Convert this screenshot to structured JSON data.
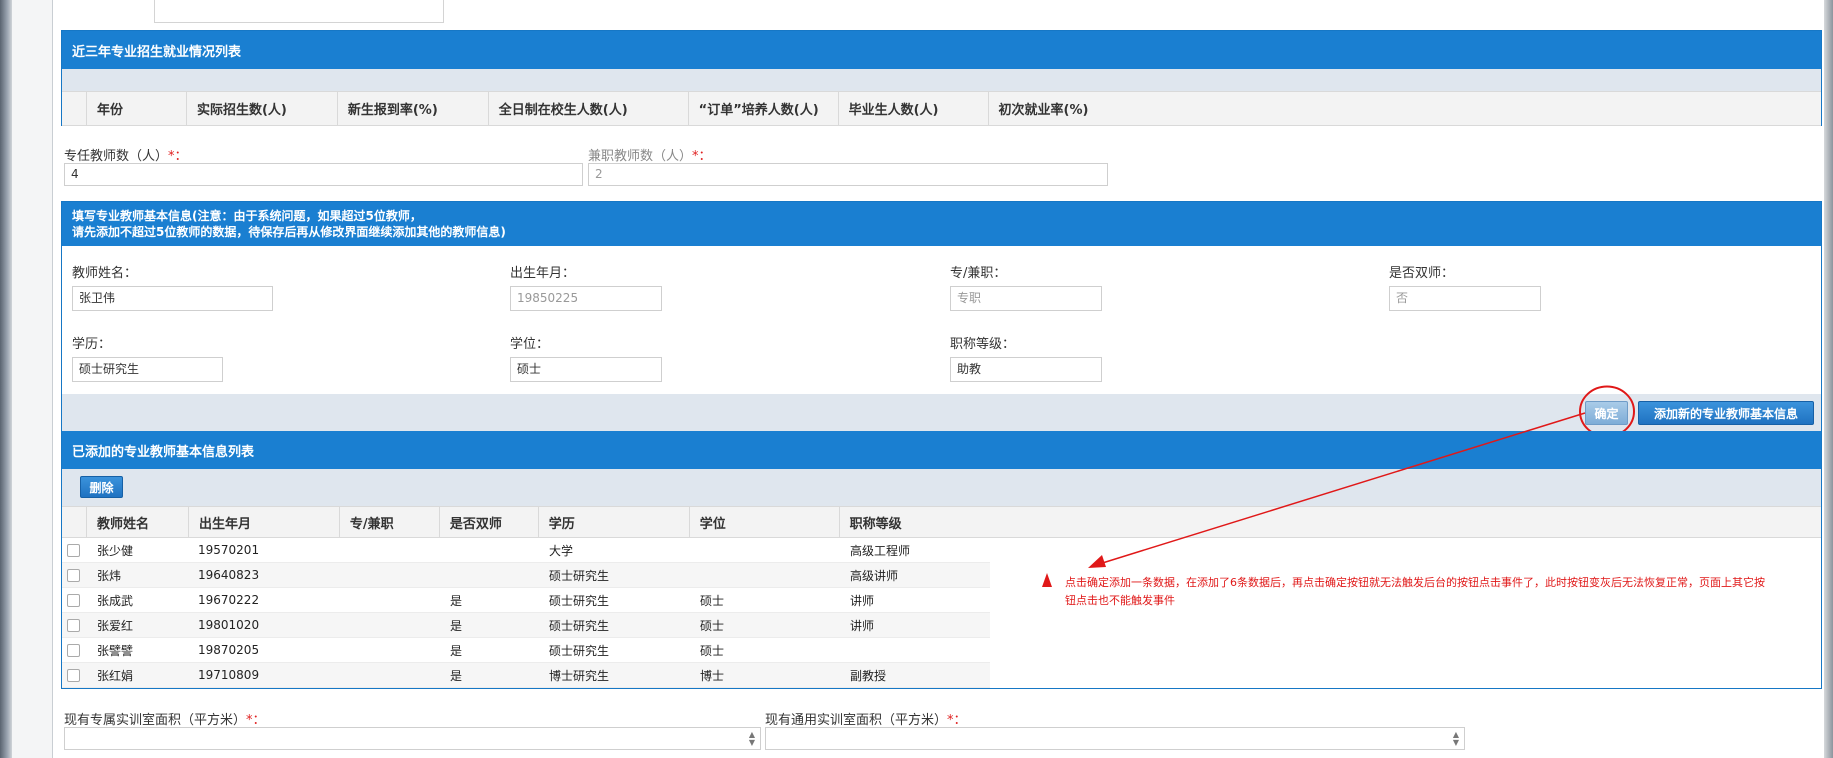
{
  "enrollment": {
    "title": "近三年专业招生就业情况列表",
    "columns": [
      "年份",
      "实际招生数(人)",
      "新生报到率(%)",
      "全日制在校生人数(人)",
      "“订单”培养人数(人)",
      "毕业生人数(人)",
      "初次就业率(%)"
    ]
  },
  "teacher_counts": {
    "fulltime_label": "专任教师数（人）",
    "fulltime_value": "4",
    "parttime_label": "兼职教师数（人）",
    "parttime_value": "2",
    "required_mark": "*："
  },
  "teacher_form": {
    "title_line1": "填写专业教师基本信息(注意：由于系统问题，如果超过5位教师，",
    "title_line2": "请先添加不超过5位教师的数据，待保存后再从修改界面继续添加其他的教师信息)",
    "name_label": "教师姓名：",
    "name_value": "张卫伟",
    "birth_label": "出生年月：",
    "birth_value": "19850225",
    "type_label": "专/兼职：",
    "type_value": "专职",
    "dual_label": "是否双师：",
    "dual_value": "否",
    "edu_label": "学历：",
    "edu_value": "硕士研究生",
    "degree_label": "学位：",
    "degree_value": "硕士",
    "title_label": "职称等级：",
    "title_value": "助教",
    "confirm_button": "确定",
    "add_new_button": "添加新的专业教师基本信息"
  },
  "teacher_list": {
    "title": "已添加的专业教师基本信息列表",
    "delete_button": "删除",
    "columns": [
      "教师姓名",
      "出生年月",
      "专/兼职",
      "是否双师",
      "学历",
      "学位",
      "职称等级"
    ],
    "rows": [
      {
        "name": "张少健",
        "birth": "19570201",
        "type": "",
        "dual": "",
        "edu": "大学",
        "degree": "",
        "title": "高级工程师"
      },
      {
        "name": "张炜",
        "birth": "19640823",
        "type": "",
        "dual": "",
        "edu": "硕士研究生",
        "degree": "",
        "title": "高级讲师"
      },
      {
        "name": "张成武",
        "birth": "19670222",
        "type": "",
        "dual": "是",
        "edu": "硕士研究生",
        "degree": "硕士",
        "title": "讲师"
      },
      {
        "name": "张爱红",
        "birth": "19801020",
        "type": "",
        "dual": "是",
        "edu": "硕士研究生",
        "degree": "硕士",
        "title": "讲师"
      },
      {
        "name": "张譬譬",
        "birth": "19870205",
        "type": "",
        "dual": "是",
        "edu": "硕士研究生",
        "degree": "硕士",
        "title": ""
      },
      {
        "name": "张红娟",
        "birth": "19710809",
        "type": "",
        "dual": "是",
        "edu": "博士研究生",
        "degree": "博士",
        "title": "副教授"
      }
    ]
  },
  "annotation": {
    "line1": "点击确定添加一条数据，在添加了6条数据后，再点击确定按钮就无法触发后台的按钮点击事件了，此时按钮变灰后无法恢复正常，页面上其它按",
    "line2": "钮点击也不能触发事件",
    "color": "#e01818"
  },
  "training_area": {
    "dedicated_label": "现有专属实训室面积（平方米）",
    "general_label": "现有通用实训室面积（平方米）",
    "required_mark": "*："
  },
  "colors": {
    "header_blue": "#1a7fd1",
    "band_gray": "#dfe6ee",
    "annotation_red": "#e01818"
  }
}
